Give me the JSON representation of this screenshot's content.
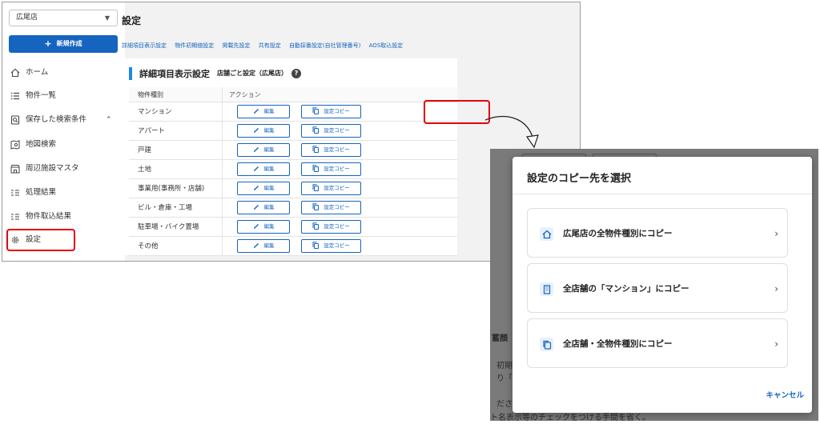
{
  "app": {
    "store_select": "広尾店",
    "new_button": "新規作成",
    "page_title": "設定",
    "nav": [
      {
        "label": "ホーム",
        "icon": "home-icon"
      },
      {
        "label": "物件一覧",
        "icon": "list-icon"
      },
      {
        "label": "保存した検索条件",
        "icon": "saved-search-icon",
        "expanded": true
      },
      {
        "label": "地図検索",
        "icon": "map-search-icon"
      },
      {
        "label": "周辺施設マスタ",
        "icon": "facility-icon"
      },
      {
        "label": "処理結果",
        "icon": "result-icon"
      },
      {
        "label": "物件取込結果",
        "icon": "import-result-icon"
      },
      {
        "label": "設定",
        "icon": "gear-icon"
      }
    ],
    "tabs": [
      "詳細項目表示設定",
      "物件初期値設定",
      "掲載先設定",
      "共有設定",
      "自動採番設定(自社管理番号)",
      "AOS取込設定"
    ],
    "section": {
      "title": "詳細項目表示設定",
      "subtitle": "店舗ごと設定（広尾店）",
      "help": "?"
    },
    "table": {
      "headers": [
        "物件種別",
        "アクション"
      ],
      "edit_label": "編集",
      "copy_label": "設定コピー",
      "rows": [
        "マンション",
        "アパート",
        "戸建",
        "土地",
        "事業用(事務所・店舗)",
        "ビル・倉庫・工場",
        "駐車場・バイク置場",
        "その他"
      ]
    }
  },
  "dialog": {
    "title": "設定のコピー先を選択",
    "options": [
      {
        "label": "広尾店の全物件種別にコピー",
        "icon": "store-icon"
      },
      {
        "label": "全店舗の「マンション」にコピー",
        "icon": "building-icon"
      },
      {
        "label": "全店舗・全物件種別にコピー",
        "icon": "copy-icon"
      }
    ],
    "cancel": "キャンセル",
    "background_text": {
      "line1": "蓄顔",
      "line2": "初期",
      "line3": "り「",
      "line4": "ださ",
      "line5": "ト名表示等のチェックをつける手間を省く。"
    }
  },
  "colors": {
    "primary": "#1565c0",
    "highlight": "#e6000f",
    "section_bar": "#1e88e5"
  }
}
